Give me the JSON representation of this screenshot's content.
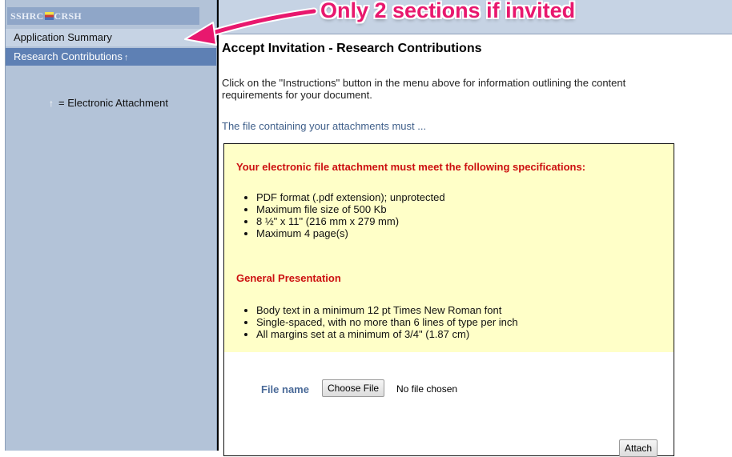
{
  "logo": {
    "left": "SSHRC",
    "right": "CRSH"
  },
  "nav": {
    "items": [
      {
        "label": "Application Summary"
      },
      {
        "label": "Research Contributions",
        "attachment_icon": "↑"
      }
    ],
    "legend": {
      "icon": "↑",
      "text": "= Electronic Attachment"
    }
  },
  "callout": {
    "text": "Only 2 sections if invited",
    "color": "#e8186e"
  },
  "main": {
    "title": "Accept Invitation - Research Contributions",
    "instructions": "Click on the \"Instructions\" button in the menu above for information outlining the content requirements for your document.",
    "must_link": "The file containing your attachments must ...",
    "spec_heading": "Your electronic file attachment must meet the following specifications:",
    "specs": [
      "PDF format (.pdf extension); unprotected",
      "Maximum file size of 500 Kb",
      "8 ½\" x 11\" (216 mm x 279 mm)",
      "Maximum 4 page(s)"
    ],
    "presentation_heading": "General Presentation",
    "presentation": [
      "Body text in a minimum 12 pt Times New Roman font",
      "Single-spaced, with no more than 6 lines of type per inch",
      "All margins set at a minimum of 3/4\" (1.87 cm)"
    ],
    "file_label": "File name",
    "choose_button": "Choose File",
    "no_file_text": "No file chosen",
    "attach_button": "Attach"
  },
  "colors": {
    "sidebar_bg": "#b3c3d8",
    "active_nav": "#5e80b4",
    "spec_bg": "#ffffc8",
    "heading_red": "#cc1010"
  }
}
